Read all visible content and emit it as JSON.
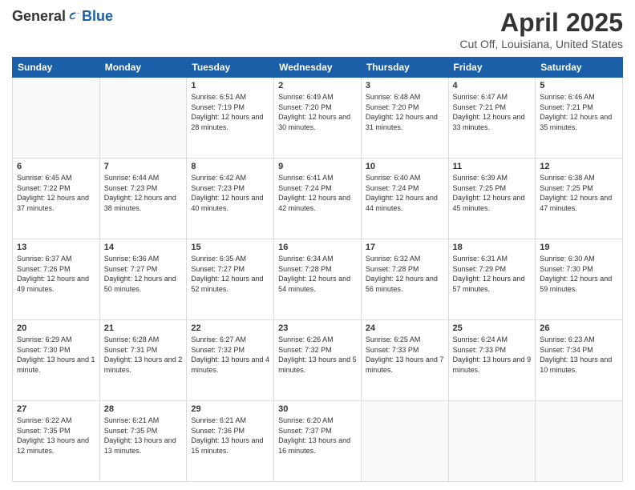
{
  "logo": {
    "general": "General",
    "blue": "Blue"
  },
  "title": "April 2025",
  "subtitle": "Cut Off, Louisiana, United States",
  "days_of_week": [
    "Sunday",
    "Monday",
    "Tuesday",
    "Wednesday",
    "Thursday",
    "Friday",
    "Saturday"
  ],
  "weeks": [
    [
      {
        "day": "",
        "empty": true
      },
      {
        "day": "",
        "empty": true
      },
      {
        "day": "1",
        "sunrise": "6:51 AM",
        "sunset": "7:19 PM",
        "daylight": "12 hours and 28 minutes."
      },
      {
        "day": "2",
        "sunrise": "6:49 AM",
        "sunset": "7:20 PM",
        "daylight": "12 hours and 30 minutes."
      },
      {
        "day": "3",
        "sunrise": "6:48 AM",
        "sunset": "7:20 PM",
        "daylight": "12 hours and 31 minutes."
      },
      {
        "day": "4",
        "sunrise": "6:47 AM",
        "sunset": "7:21 PM",
        "daylight": "12 hours and 33 minutes."
      },
      {
        "day": "5",
        "sunrise": "6:46 AM",
        "sunset": "7:21 PM",
        "daylight": "12 hours and 35 minutes."
      }
    ],
    [
      {
        "day": "6",
        "sunrise": "6:45 AM",
        "sunset": "7:22 PM",
        "daylight": "12 hours and 37 minutes."
      },
      {
        "day": "7",
        "sunrise": "6:44 AM",
        "sunset": "7:23 PM",
        "daylight": "12 hours and 38 minutes."
      },
      {
        "day": "8",
        "sunrise": "6:42 AM",
        "sunset": "7:23 PM",
        "daylight": "12 hours and 40 minutes."
      },
      {
        "day": "9",
        "sunrise": "6:41 AM",
        "sunset": "7:24 PM",
        "daylight": "12 hours and 42 minutes."
      },
      {
        "day": "10",
        "sunrise": "6:40 AM",
        "sunset": "7:24 PM",
        "daylight": "12 hours and 44 minutes."
      },
      {
        "day": "11",
        "sunrise": "6:39 AM",
        "sunset": "7:25 PM",
        "daylight": "12 hours and 45 minutes."
      },
      {
        "day": "12",
        "sunrise": "6:38 AM",
        "sunset": "7:25 PM",
        "daylight": "12 hours and 47 minutes."
      }
    ],
    [
      {
        "day": "13",
        "sunrise": "6:37 AM",
        "sunset": "7:26 PM",
        "daylight": "12 hours and 49 minutes."
      },
      {
        "day": "14",
        "sunrise": "6:36 AM",
        "sunset": "7:27 PM",
        "daylight": "12 hours and 50 minutes."
      },
      {
        "day": "15",
        "sunrise": "6:35 AM",
        "sunset": "7:27 PM",
        "daylight": "12 hours and 52 minutes."
      },
      {
        "day": "16",
        "sunrise": "6:34 AM",
        "sunset": "7:28 PM",
        "daylight": "12 hours and 54 minutes."
      },
      {
        "day": "17",
        "sunrise": "6:32 AM",
        "sunset": "7:28 PM",
        "daylight": "12 hours and 56 minutes."
      },
      {
        "day": "18",
        "sunrise": "6:31 AM",
        "sunset": "7:29 PM",
        "daylight": "12 hours and 57 minutes."
      },
      {
        "day": "19",
        "sunrise": "6:30 AM",
        "sunset": "7:30 PM",
        "daylight": "12 hours and 59 minutes."
      }
    ],
    [
      {
        "day": "20",
        "sunrise": "6:29 AM",
        "sunset": "7:30 PM",
        "daylight": "13 hours and 1 minute."
      },
      {
        "day": "21",
        "sunrise": "6:28 AM",
        "sunset": "7:31 PM",
        "daylight": "13 hours and 2 minutes."
      },
      {
        "day": "22",
        "sunrise": "6:27 AM",
        "sunset": "7:32 PM",
        "daylight": "13 hours and 4 minutes."
      },
      {
        "day": "23",
        "sunrise": "6:26 AM",
        "sunset": "7:32 PM",
        "daylight": "13 hours and 5 minutes."
      },
      {
        "day": "24",
        "sunrise": "6:25 AM",
        "sunset": "7:33 PM",
        "daylight": "13 hours and 7 minutes."
      },
      {
        "day": "25",
        "sunrise": "6:24 AM",
        "sunset": "7:33 PM",
        "daylight": "13 hours and 9 minutes."
      },
      {
        "day": "26",
        "sunrise": "6:23 AM",
        "sunset": "7:34 PM",
        "daylight": "13 hours and 10 minutes."
      }
    ],
    [
      {
        "day": "27",
        "sunrise": "6:22 AM",
        "sunset": "7:35 PM",
        "daylight": "13 hours and 12 minutes."
      },
      {
        "day": "28",
        "sunrise": "6:21 AM",
        "sunset": "7:35 PM",
        "daylight": "13 hours and 13 minutes."
      },
      {
        "day": "29",
        "sunrise": "6:21 AM",
        "sunset": "7:36 PM",
        "daylight": "13 hours and 15 minutes."
      },
      {
        "day": "30",
        "sunrise": "6:20 AM",
        "sunset": "7:37 PM",
        "daylight": "13 hours and 16 minutes."
      },
      {
        "day": "",
        "empty": true
      },
      {
        "day": "",
        "empty": true
      },
      {
        "day": "",
        "empty": true
      }
    ]
  ]
}
